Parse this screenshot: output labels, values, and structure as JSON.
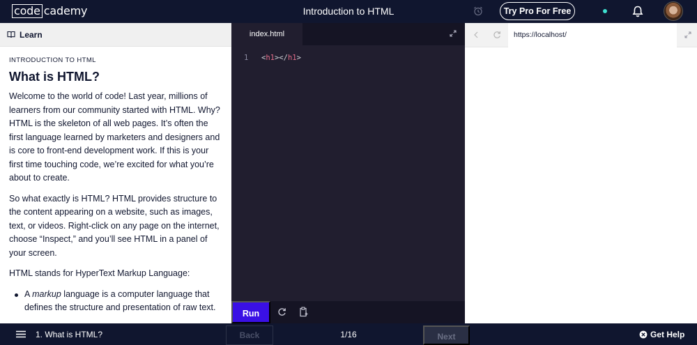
{
  "app": {
    "logo_left": "code",
    "logo_right": "cademy",
    "title": "Introduction to HTML",
    "pro_button": "Try Pro For Free",
    "accent": "#3a10e5",
    "status_dot_color": "#3ee0d0"
  },
  "learn_panel": {
    "header": "Learn",
    "kicker": "INTRODUCTION TO HTML",
    "title": "What is HTML?",
    "paragraphs": [
      "Welcome to the world of code! Last year, millions of learners from our community started with HTML. Why? HTML is the skeleton of all web pages. It’s often the first language learned by marketers and designers and is core to front-end development work. If this is your first time touching code, we’re excited for what you’re about to create.",
      "So what exactly is HTML? HTML provides structure to the content appearing on a website, such as images, text, or videos. Right-click on any page on the internet, choose “Inspect,” and you’ll see HTML in a panel of your screen.",
      "HTML stands for HyperText Markup Language:"
    ],
    "bullet_prefix": "A ",
    "bullet_em": "markup",
    "bullet_rest": " language is a computer language that defines the structure and presentation of raw text."
  },
  "editor": {
    "tab": "index.html",
    "line_number": "1",
    "code_open_lt": "<",
    "code_open_tag": "h1",
    "code_mid": "></",
    "code_close_tag": "h1",
    "code_close_gt": ">",
    "run_label": "Run"
  },
  "browser": {
    "url": "https://localhost/"
  },
  "footer": {
    "step": "1. What is HTML?",
    "back": "Back",
    "pages": "1/16",
    "next": "Next",
    "help": "Get Help"
  }
}
